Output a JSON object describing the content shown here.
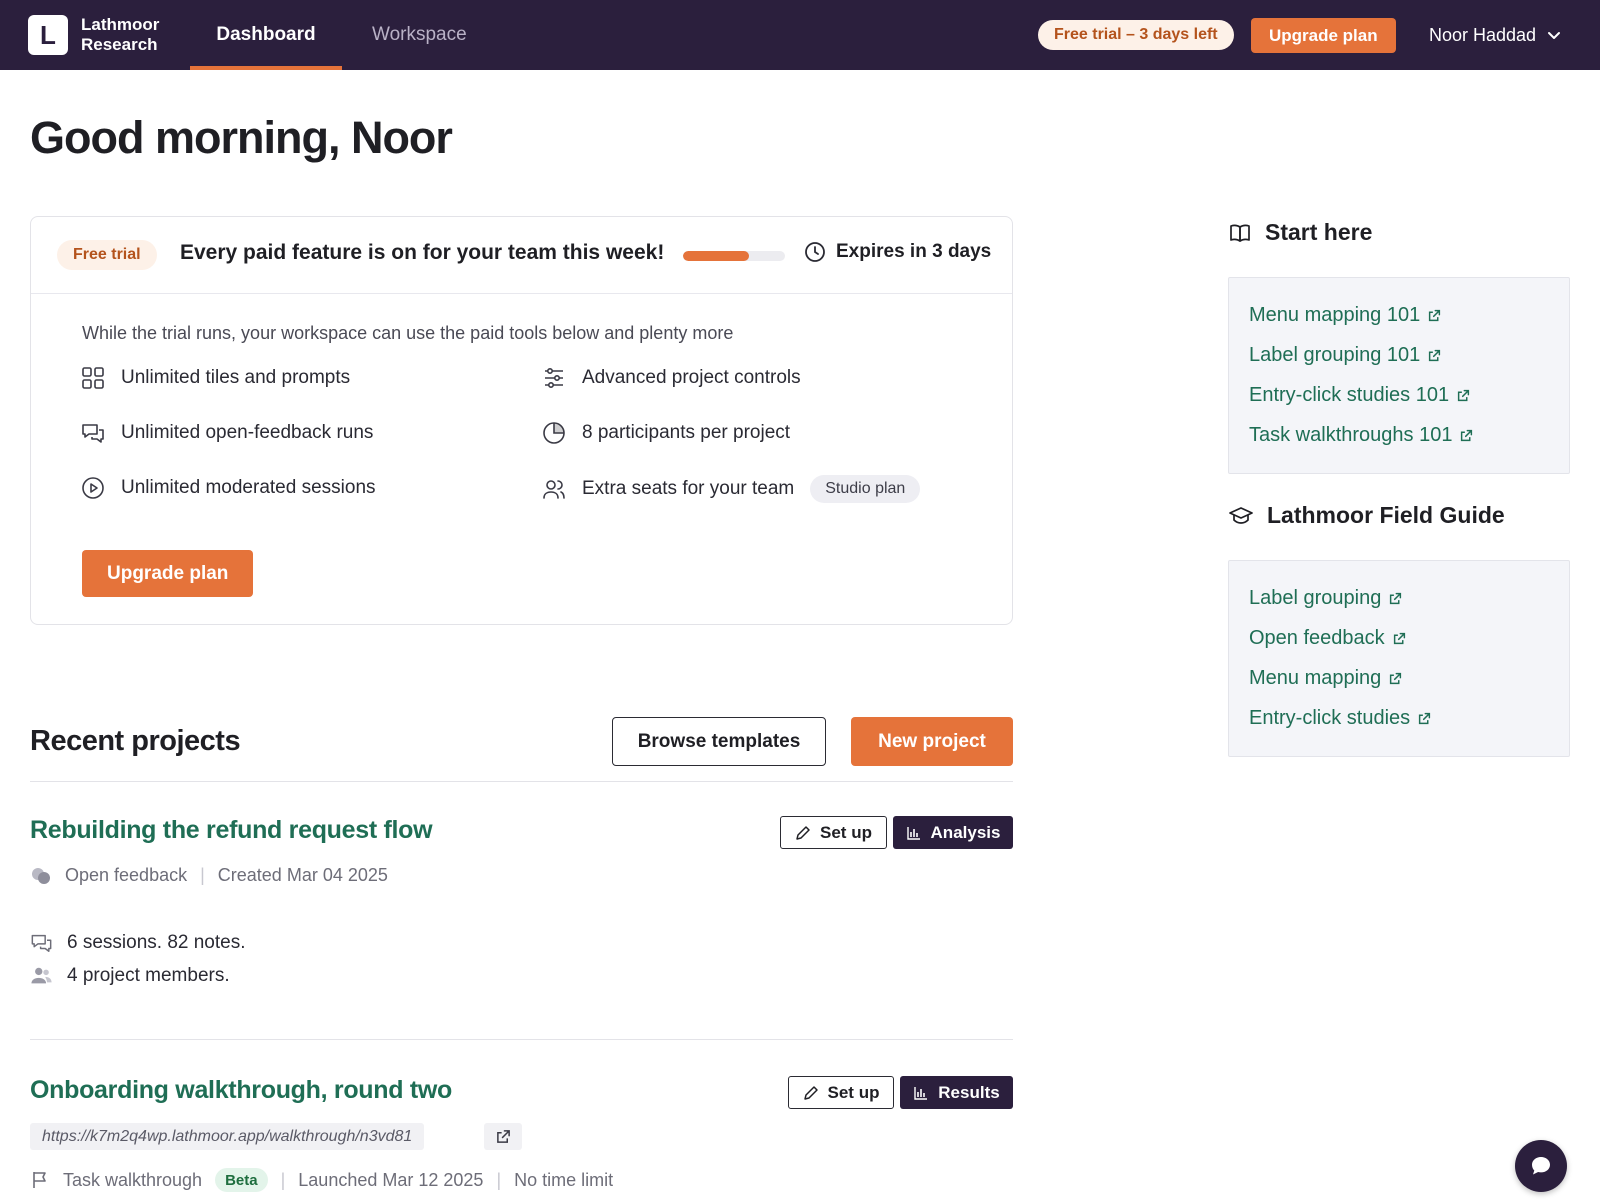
{
  "brand": {
    "line1": "Lathmoor",
    "line2": "Research",
    "logo_letter": "L"
  },
  "nav": {
    "tabs": [
      {
        "label": "Dashboard",
        "active": true
      },
      {
        "label": "Workspace",
        "active": false
      }
    ]
  },
  "header": {
    "trial_pill": "Free trial – 3 days left",
    "upgrade_label": "Upgrade plan",
    "user_name": "Noor Haddad"
  },
  "greeting": "Good morning, Noor",
  "trial_card": {
    "badge": "Free trial",
    "headline": "Every paid feature is on for your team this week!",
    "progress": 0.65,
    "expires": "Expires in 3 days",
    "intro": "While the trial runs, your workspace can use the paid tools below and plenty more",
    "features_left": [
      {
        "icon": "grid-icon",
        "label": "Unlimited tiles and prompts"
      },
      {
        "icon": "chat-bubbles-icon",
        "label": "Unlimited open-feedback runs"
      },
      {
        "icon": "play-circle-icon",
        "label": "Unlimited moderated sessions"
      }
    ],
    "features_right": [
      {
        "icon": "sliders-icon",
        "label": "Advanced project controls"
      },
      {
        "icon": "pie-icon",
        "label": "8 participants per project"
      },
      {
        "icon": "users-icon",
        "label": "Extra seats for your team",
        "tag": "Studio plan"
      }
    ],
    "upgrade_label": "Upgrade plan"
  },
  "recent": {
    "title": "Recent projects",
    "browse_label": "Browse templates",
    "new_label": "New project",
    "projects": [
      {
        "title": "Rebuilding the refund request flow",
        "setup_label": "Set up",
        "analysis_label": "Analysis",
        "type": "Open feedback",
        "created": "Created Mar 04 2025",
        "sessions": "6 sessions. 82 notes.",
        "members": "4 project members."
      },
      {
        "title": "Onboarding walkthrough, round two",
        "setup_label": "Set up",
        "results_label": "Results",
        "url": "https://k7m2q4wp.lathmoor.app/walkthrough/n3vd81",
        "type": "Task walkthrough",
        "beta": "Beta",
        "launched": "Launched Mar 12 2025",
        "time_limit": "No time limit"
      }
    ]
  },
  "sidebar": {
    "start_here": {
      "title": "Start here",
      "links": [
        "Menu mapping 101",
        "Label grouping 101",
        "Entry-click studies 101",
        "Task walkthroughs 101"
      ]
    },
    "field_guide": {
      "title": "Lathmoor Field Guide",
      "links": [
        "Label grouping",
        "Open feedback",
        "Menu mapping",
        "Entry-click studies"
      ]
    }
  },
  "colors": {
    "accent": "#e5733a",
    "brand_dark": "#2b1f3d",
    "link_green": "#1f6e55"
  }
}
